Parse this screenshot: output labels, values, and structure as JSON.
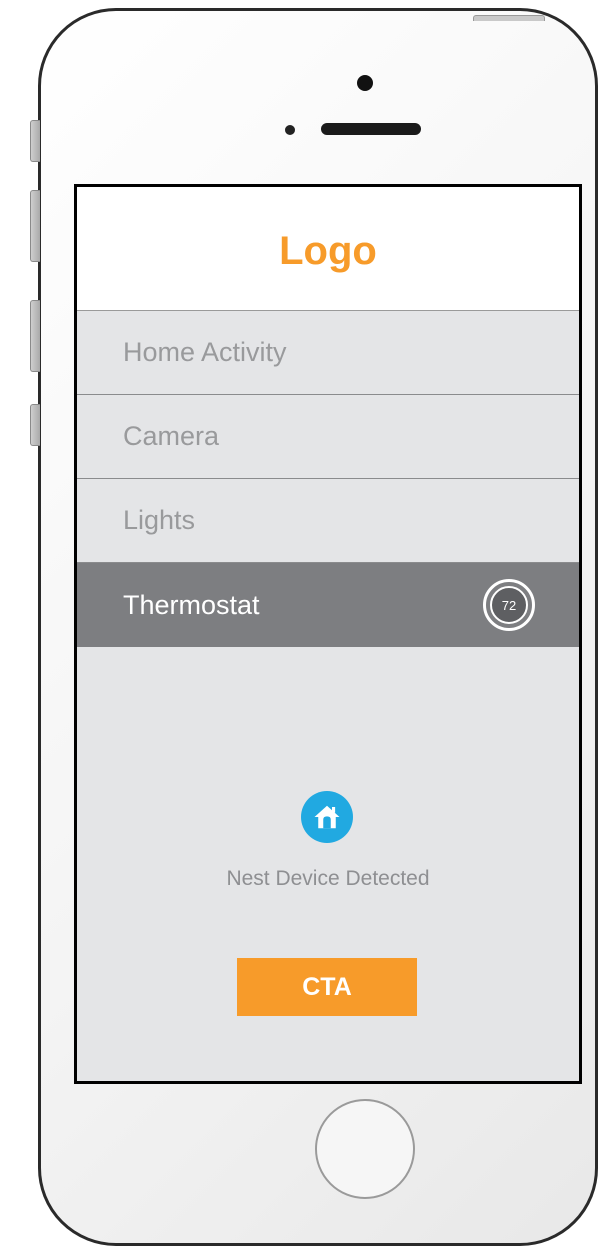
{
  "header": {
    "logo": "Logo"
  },
  "menu": {
    "items": [
      {
        "label": "Home Activity"
      },
      {
        "label": "Camera"
      },
      {
        "label": "Lights"
      },
      {
        "label": "Thermostat"
      }
    ],
    "active": "Thermostat"
  },
  "thermostat": {
    "temperature": "72"
  },
  "status": {
    "icon": "home-icon",
    "message": "Nest Device Detected"
  },
  "cta": {
    "label": "CTA"
  },
  "colors": {
    "accent": "#f79b2a",
    "nest_blue": "#21a9e1",
    "active_row": "#7d7e81",
    "screen_bg": "#e4e5e7"
  }
}
